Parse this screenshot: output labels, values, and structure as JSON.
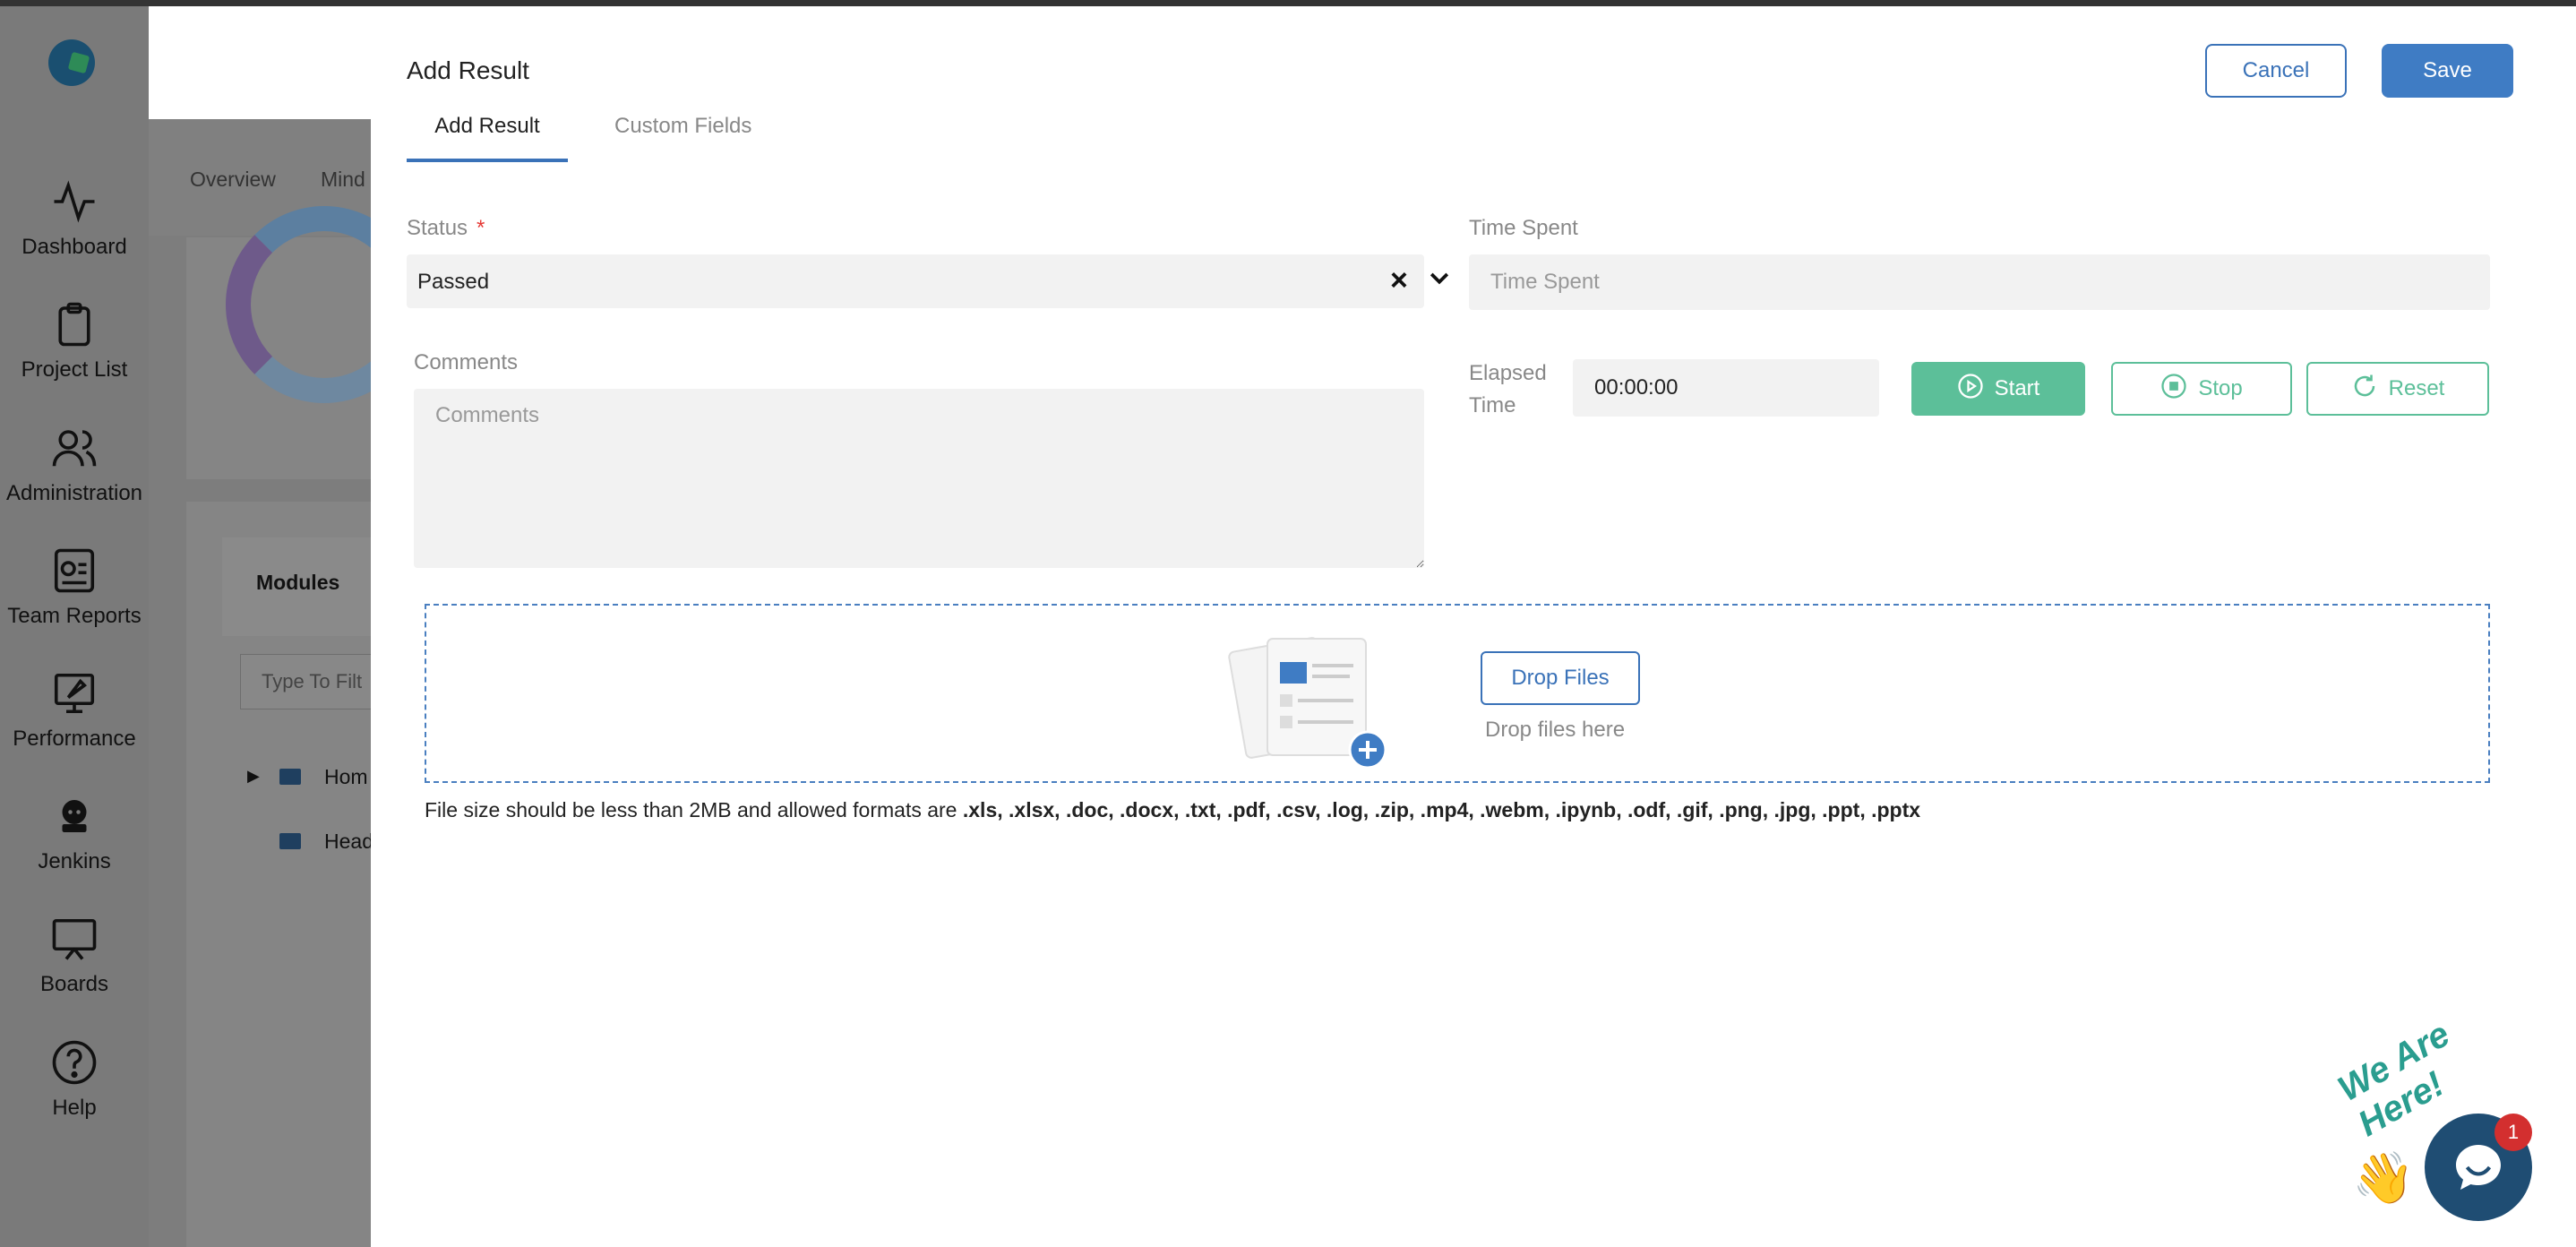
{
  "sidebar": {
    "items": [
      {
        "label": "Dashboard",
        "icon": "activity-icon"
      },
      {
        "label": "Project List",
        "icon": "clipboard-icon"
      },
      {
        "label": "Administration",
        "icon": "users-icon"
      },
      {
        "label": "Team Reports",
        "icon": "report-icon"
      },
      {
        "label": "Performance",
        "icon": "rocket-icon"
      },
      {
        "label": "Jenkins",
        "icon": "jenkins-icon"
      },
      {
        "label": "Boards",
        "icon": "board-icon"
      },
      {
        "label": "Help",
        "icon": "help-icon"
      }
    ]
  },
  "background": {
    "tabs": [
      "Overview",
      "Mind"
    ],
    "modules_label": "Modules",
    "filter_placeholder": "Type To Filt",
    "tree": [
      "Hom",
      "Head"
    ]
  },
  "modal": {
    "title": "Add Result",
    "cancel_label": "Cancel",
    "save_label": "Save",
    "tabs": [
      "Add Result",
      "Custom Fields"
    ],
    "status": {
      "label": "Status",
      "required_mark": "*",
      "value": "Passed"
    },
    "time_spent": {
      "label": "Time Spent",
      "placeholder": "Time Spent"
    },
    "comments": {
      "label": "Comments",
      "placeholder": "Comments"
    },
    "elapsed": {
      "label_line1": "Elapsed",
      "label_line2": "Time",
      "value": "00:00:00"
    },
    "timer": {
      "start": "Start",
      "stop": "Stop",
      "reset": "Reset"
    },
    "dropzone": {
      "button": "Drop Files",
      "hint": "Drop files here"
    },
    "file_note": {
      "prefix": "File size should be less than 2MB and allowed formats are ",
      "formats": ".xls, .xlsx, .doc, .docx, .txt, .pdf, .csv, .log, .zip, .mp4, .webm, .ipynb, .odf, .gif, .png, .jpg, .ppt, .pptx"
    }
  },
  "chat": {
    "banner": "We Are Here!",
    "badge": "1"
  },
  "colors": {
    "primary": "#3f7cc4",
    "success": "#5cbf99",
    "required": "#e53935",
    "badge": "#d32f2f"
  }
}
